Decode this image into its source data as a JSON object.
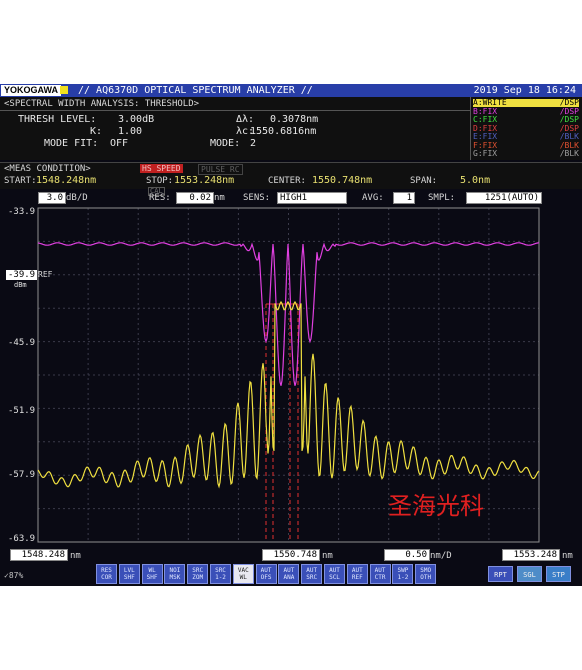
{
  "header": {
    "brand": "YOKOGAWA",
    "model": "// AQ6370D OPTICAL SPECTRUM ANALYZER //",
    "datetime": "2019 Sep 18 16:24"
  },
  "analysis": {
    "title": "<SPECTRAL WIDTH ANALYSIS: THRESHOLD>",
    "thresh_label": "THRESH LEVEL:",
    "thresh_value": "3.00dB",
    "k_label": "K:",
    "k_value": "1.00",
    "mode_fit_label": "MODE FIT:",
    "mode_fit_value": "OFF",
    "dlambda_label": "Δλ:",
    "dlambda_value": "0.3078nm",
    "lambdac_label": "λc:",
    "lambdac_value": "1550.6816nm",
    "mode_label": "MODE:",
    "mode_value": "2"
  },
  "traces": [
    {
      "name": "A:WRITE",
      "mode": "/DSP",
      "color": "#f0e040",
      "highlight": true
    },
    {
      "name": "B:FIX",
      "mode": "/DSP",
      "color": "#e040e0",
      "highlight": false
    },
    {
      "name": "C:FIX",
      "mode": "/DSP",
      "color": "#40e040",
      "highlight": false
    },
    {
      "name": "D:FIX",
      "mode": "/DSP",
      "color": "#e04040",
      "highlight": false
    },
    {
      "name": "E:FIX",
      "mode": "/BLK",
      "color": "#5060c0",
      "highlight": false
    },
    {
      "name": "F:FIX",
      "mode": "/BLK",
      "color": "#e05030",
      "highlight": false
    },
    {
      "name": "G:FIX",
      "mode": "/BLK",
      "color": "#a0a0a0",
      "highlight": false
    }
  ],
  "meas": {
    "title": "<MEAS CONDITION>",
    "badge1": "HS SPEED",
    "badge2": "PULSE RC",
    "start_label": "START:",
    "start_value": "1548.248nm",
    "stop_label": "STOP:",
    "stop_value": "1553.248nm",
    "center_label": "CENTER:",
    "center_value": "1550.748nm",
    "span_label": "SPAN:",
    "span_value": "5.0nm",
    "cal_label": "CAL",
    "scale_value": "3.0",
    "scale_unit": "dB/D",
    "res_label": "RES:",
    "res_value": "0.02",
    "res_unit": "nm",
    "sens_label": "SENS:",
    "sens_value": "HIGH1",
    "avg_label": "AVG:",
    "avg_value": "1",
    "smpl_label": "SMPL:",
    "smpl_value": "1251(AUTO)"
  },
  "graph": {
    "y_labels": [
      "-33.9",
      "-39.9",
      "-45.9",
      "-51.9",
      "-57.9",
      "-63.9"
    ],
    "ref_value": "-39.9",
    "ref_label": "REF",
    "ref_unit": "dBm",
    "watermark": "圣海光科"
  },
  "bottom": {
    "start_value": "1548.248",
    "start_unit": "nm",
    "center_value": "1550.748",
    "center_unit": "nm",
    "div_value": "0.50",
    "div_unit": "nm/D",
    "stop_value": "1553.248",
    "stop_unit": "nm"
  },
  "status": {
    "percent": "✓87%",
    "soft_buttons": [
      {
        "line1": "RES",
        "line2": "COR",
        "alt": false
      },
      {
        "line1": "LVL",
        "line2": "SHF",
        "alt": false
      },
      {
        "line1": "WL",
        "line2": "SHF",
        "alt": false
      },
      {
        "line1": "NOI",
        "line2": "MSK",
        "alt": false
      },
      {
        "line1": "SRC",
        "line2": "ZOM",
        "alt": false
      },
      {
        "line1": "SRC",
        "line2": "1-2",
        "alt": false
      },
      {
        "line1": "VAC",
        "line2": "WL",
        "alt": true
      },
      {
        "line1": "AUT",
        "line2": "OFS",
        "alt": false
      },
      {
        "line1": "AUT",
        "line2": "ANA",
        "alt": false
      },
      {
        "line1": "AUT",
        "line2": "SRC",
        "alt": false
      },
      {
        "line1": "AUT",
        "line2": "SCL",
        "alt": false
      },
      {
        "line1": "AUT",
        "line2": "REF",
        "alt": false
      },
      {
        "line1": "AUT",
        "line2": "CTR",
        "alt": false
      },
      {
        "line1": "SWP",
        "line2": "1-2",
        "alt": false
      },
      {
        "line1": "SMO",
        "line2": "OTH",
        "alt": false
      }
    ],
    "rpt": "RPT",
    "sgl": "SGL",
    "stp": "STP"
  },
  "colors": {
    "trace_a": "#f0e040",
    "trace_b": "#e040e0",
    "marker": "#e03030",
    "watermark": "#e02020"
  }
}
